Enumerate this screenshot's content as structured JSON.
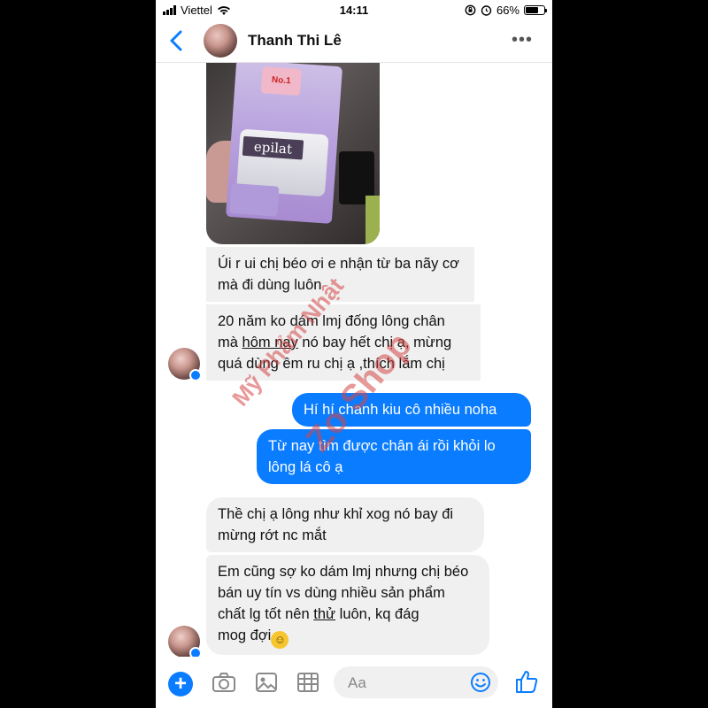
{
  "status_bar": {
    "carrier": "Viettel",
    "time": "14:11",
    "battery": "66%"
  },
  "header": {
    "contact_name": "Thanh Thi Lê",
    "more_label": "•••"
  },
  "photo": {
    "product_text": "epilat",
    "badge_text": "No.1"
  },
  "messages": [
    {
      "side": "in",
      "text": "Úi r ui chị béo ơi e nhận từ ba nãy cơ mà đi dùng luôn"
    },
    {
      "side": "in",
      "line1": "20 năm ko dám lmj đống lông chân",
      "line2_before": "mà ",
      "line2_underline": "hôm nay",
      "line2_after": " nó bay hết chị ạ, mừng",
      "line3": "quá dùng êm ru chị ạ ,thích lắm chị"
    },
    {
      "side": "out",
      "text": "Hí hí chanh kiu cô nhiều noha"
    },
    {
      "side": "out",
      "text": "Từ nay tìm được chân ái rồi khỏi lo lông lá cô ạ"
    },
    {
      "side": "in",
      "text": "Thề chị ạ lông như khỉ xog nó bay đi mừng rớt nc mắt"
    },
    {
      "side": "in",
      "line1": "Em cũng sợ ko dám lmj nhưng chị béo",
      "line2": "bán uy tín vs dùng nhiều sản phẩm",
      "line3_before": "chất lg tốt nên ",
      "line3_underline": "thử",
      "line3_after": " luôn, kq đág",
      "line4": "mog đợi",
      "emoji": "grinning-face-emoji"
    }
  ],
  "watermark": {
    "line1": "Mỹ Phẩm Nhật",
    "line2": "Zo Shop"
  },
  "composer": {
    "placeholder": "Aa"
  },
  "colors": {
    "accent": "#0a7cff",
    "incoming_bubble": "#f0f0f0",
    "watermark": "#d64646"
  }
}
